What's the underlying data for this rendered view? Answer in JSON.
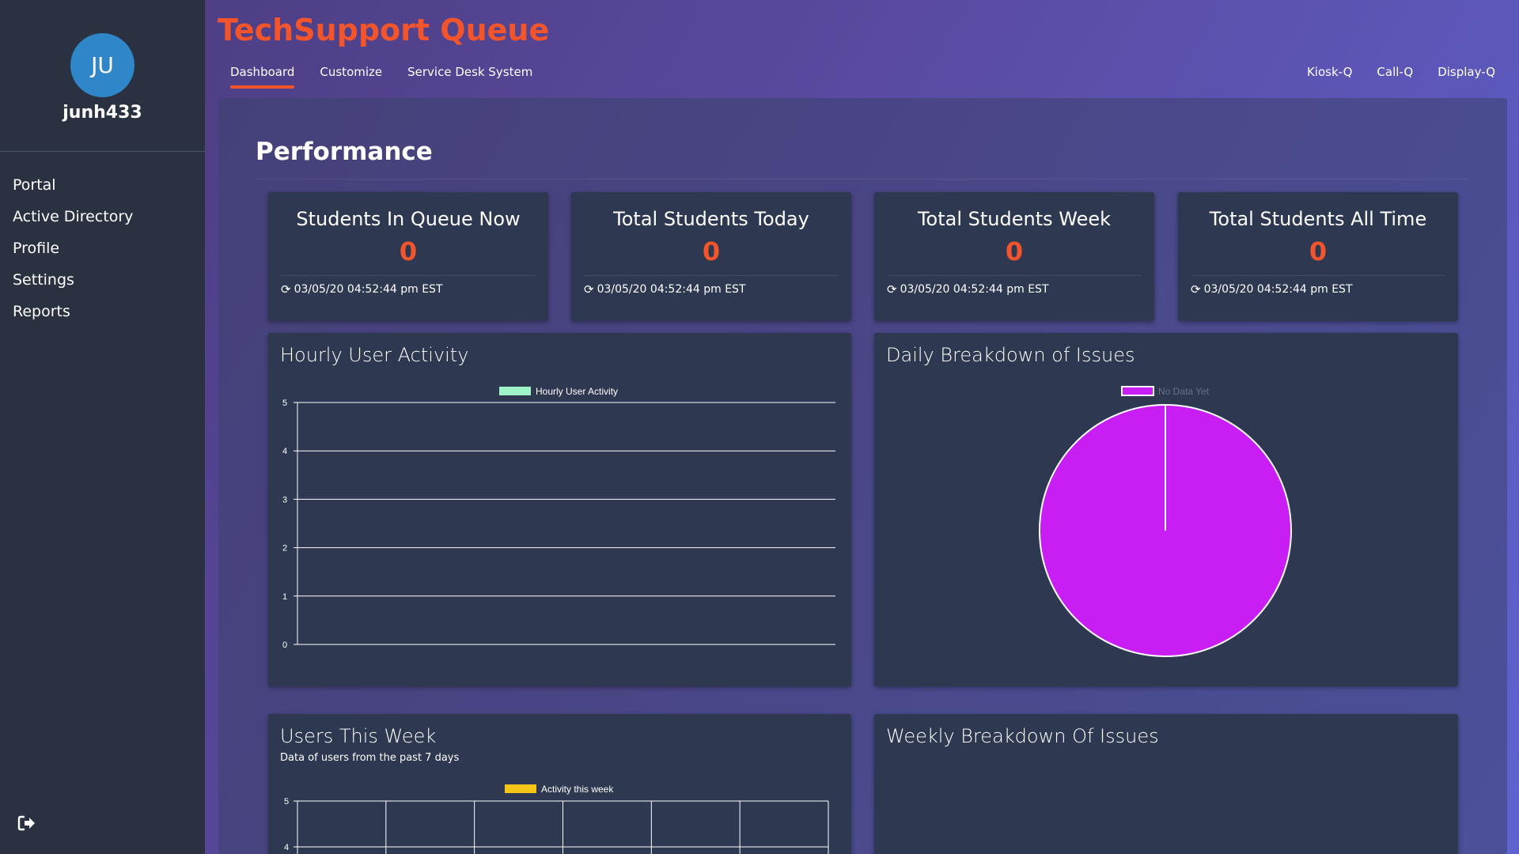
{
  "user": {
    "initials": "JU",
    "username": "junh433"
  },
  "sidebar": {
    "items": [
      {
        "label": "Portal"
      },
      {
        "label": "Active Directory"
      },
      {
        "label": "Profile"
      },
      {
        "label": "Settings"
      },
      {
        "label": "Reports"
      }
    ]
  },
  "header": {
    "title": "TechSupport Queue",
    "tabs": [
      {
        "label": "Dashboard",
        "active": true
      },
      {
        "label": "Customize"
      },
      {
        "label": "Service Desk System"
      }
    ],
    "right_links": [
      {
        "label": "Kiosk-Q"
      },
      {
        "label": "Call-Q"
      },
      {
        "label": "Display-Q"
      }
    ]
  },
  "main": {
    "title": "Performance",
    "stats": [
      {
        "label": "Students In Queue Now",
        "value": "0",
        "timestamp": "03/05/20 04:52:44 pm EST"
      },
      {
        "label": "Total Students Today",
        "value": "0",
        "timestamp": "03/05/20 04:52:44 pm EST"
      },
      {
        "label": "Total Students Week",
        "value": "0",
        "timestamp": "03/05/20 04:52:44 pm EST"
      },
      {
        "label": "Total Students All Time",
        "value": "0",
        "timestamp": "03/05/20 04:52:44 pm EST"
      }
    ],
    "cards": {
      "hourly": {
        "title": "Hourly User Activity",
        "legend": "Hourly User Activity"
      },
      "daily": {
        "title": "Daily Breakdown of Issues",
        "legend": "No Data Yet"
      },
      "week": {
        "title": "Users This Week",
        "subtitle": "Data of users from the past 7 days",
        "legend": "Activity this week"
      },
      "weekly_issues": {
        "title": "Weekly Breakdown Of Issues"
      }
    }
  },
  "colors": {
    "accent": "#f2552c",
    "hourly_series": "#9ff5c8",
    "daily_series": "#c81df3",
    "week_series": "#f5c518"
  },
  "icons": {
    "refresh": "refresh-icon",
    "logout": "logout-icon"
  },
  "chart_data": [
    {
      "type": "line",
      "title": "Hourly User Activity",
      "series": [
        {
          "name": "Hourly User Activity",
          "values": []
        }
      ],
      "yticks": [
        "0",
        "1",
        "2",
        "3",
        "4",
        "5"
      ],
      "ylim": [
        0,
        5
      ],
      "grid": true,
      "legend": "top-center"
    },
    {
      "type": "pie",
      "title": "Daily Breakdown of Issues",
      "categories": [
        "No Data Yet"
      ],
      "values": [
        1
      ],
      "legend": "top-center"
    },
    {
      "type": "bar",
      "title": "Users This Week",
      "subtitle": "Data of users from the past 7 days",
      "series": [
        {
          "name": "Activity this week",
          "values": []
        }
      ],
      "yticks_visible": [
        "5",
        "4"
      ],
      "ylim": [
        0,
        5
      ],
      "grid": true,
      "legend": "top-center"
    }
  ]
}
